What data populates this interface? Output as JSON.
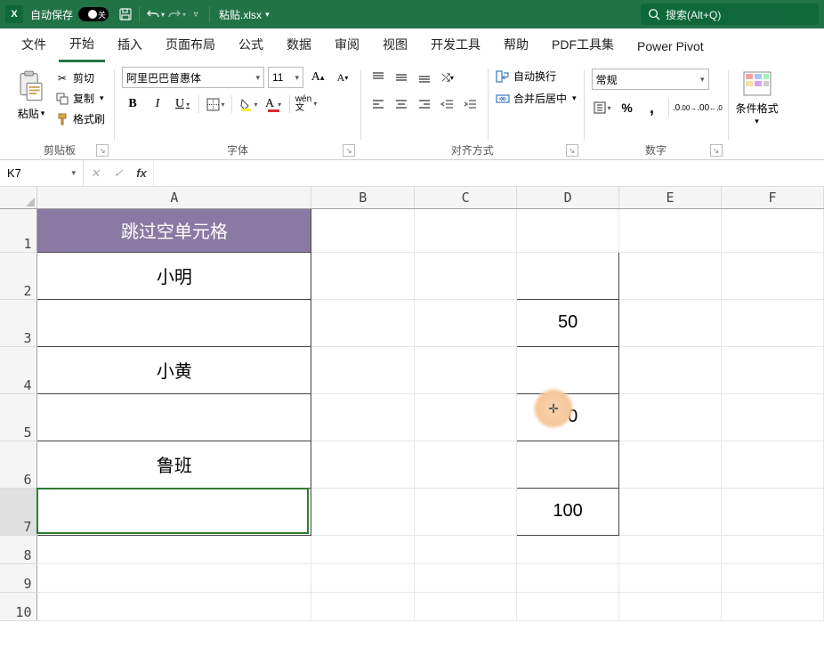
{
  "titlebar": {
    "autosave_label": "自动保存",
    "autosave_state": "关",
    "filename": "粘贴.xlsx",
    "search_placeholder": "搜索(Alt+Q)"
  },
  "menu": {
    "tabs": [
      "文件",
      "开始",
      "插入",
      "页面布局",
      "公式",
      "数据",
      "审阅",
      "视图",
      "开发工具",
      "帮助",
      "PDF工具集",
      "Power Pivot"
    ],
    "active": 1
  },
  "ribbon": {
    "clipboard": {
      "label": "剪贴板",
      "paste": "粘贴",
      "cut": "剪切",
      "copy": "复制",
      "format_painter": "格式刷"
    },
    "font": {
      "label": "字体",
      "name": "阿里巴巴普惠体",
      "size": "11"
    },
    "alignment": {
      "label": "对齐方式",
      "wrap": "自动换行",
      "merge": "合并后居中"
    },
    "number": {
      "label": "数字",
      "format": "常规"
    },
    "cond_format": "条件格式"
  },
  "formula_bar": {
    "name_box": "K7",
    "value": ""
  },
  "columns": [
    "A",
    "B",
    "C",
    "D",
    "E",
    "F"
  ],
  "rows": [
    1,
    2,
    3,
    4,
    5,
    6,
    7,
    8,
    9,
    10
  ],
  "cells": {
    "A1": "跳过空单元格",
    "A2": "小明",
    "A4": "小黄",
    "A6": "鲁班",
    "D3": "50",
    "D5": "90",
    "D7": "100"
  }
}
